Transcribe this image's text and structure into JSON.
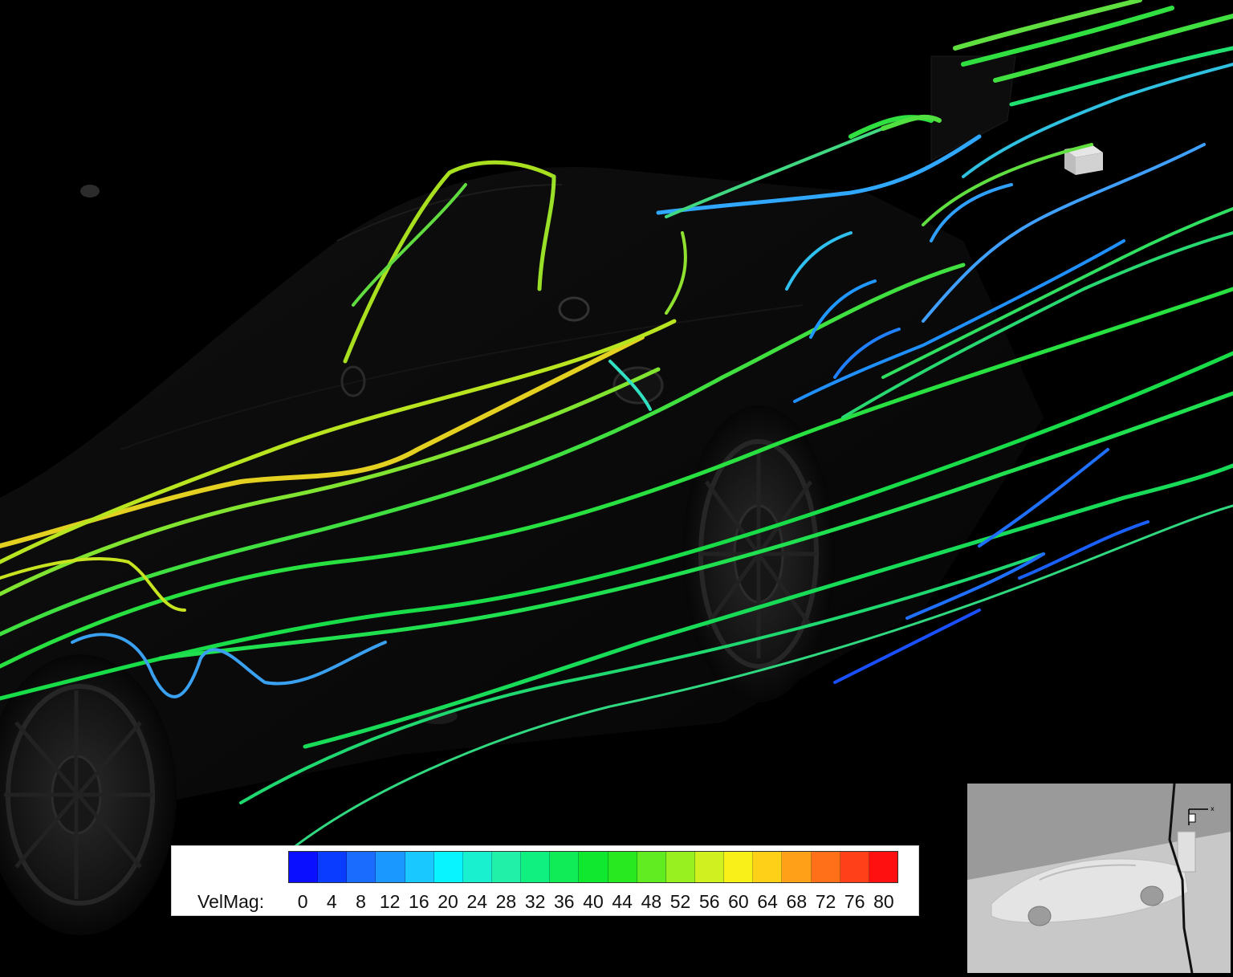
{
  "legend": {
    "variable_label": "VelMag:",
    "ticks": [
      "0",
      "4",
      "8",
      "12",
      "16",
      "20",
      "24",
      "28",
      "32",
      "36",
      "40",
      "44",
      "48",
      "52",
      "56",
      "60",
      "64",
      "68",
      "72",
      "76",
      "80"
    ],
    "colors": [
      "#0a10ff",
      "#0a3cff",
      "#1a6cff",
      "#1a98ff",
      "#18c8ff",
      "#08f4ff",
      "#18f0d0",
      "#20f0a8",
      "#10f080",
      "#10ec58",
      "#10e830",
      "#28e820",
      "#60ec20",
      "#98f020",
      "#d0f020",
      "#f8f018",
      "#ffd018",
      "#ffa018",
      "#ff7018",
      "#ff4018",
      "#ff1010"
    ]
  },
  "inset_view": {
    "axis_label": "x"
  },
  "colors": {
    "background": "#000000",
    "low_velocity": "#0a10ff",
    "mid_velocity": "#10e830",
    "high_velocity": "#ff1010"
  }
}
